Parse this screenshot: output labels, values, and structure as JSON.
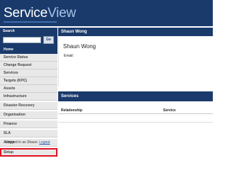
{
  "app": {
    "logo_part1": "Service",
    "logo_part2": "View"
  },
  "search": {
    "label": "Search",
    "value": "",
    "button": "Go"
  },
  "sidebar": {
    "items": [
      {
        "label": "Home",
        "active": true
      },
      {
        "label": "Service Status"
      },
      {
        "label": "Change Request"
      },
      {
        "label": "Services"
      },
      {
        "label": "Targets (KPC)"
      },
      {
        "label": "Assets"
      },
      {
        "label": "Infrastructure"
      },
      {
        "label": "Disaster Recovery"
      },
      {
        "label": "Organisation"
      },
      {
        "label": "Finance"
      },
      {
        "label": "SLA"
      },
      {
        "label": "Admin"
      },
      {
        "label": "Setup",
        "highlighted": true
      }
    ],
    "logged_in_prefix": "Logged in as",
    "logged_in_user": "Shaun.",
    "logout_label": "Logout"
  },
  "profile": {
    "header": "Shaun Wong",
    "name": "Shaun Wong",
    "email_label": "Email:",
    "email_value": ""
  },
  "services": {
    "header": "Services",
    "columns": [
      "Relationship",
      "Service"
    ],
    "rows": []
  },
  "colors": {
    "brand_navy": "#1a3a6b",
    "highlight_red": "#e01020"
  }
}
